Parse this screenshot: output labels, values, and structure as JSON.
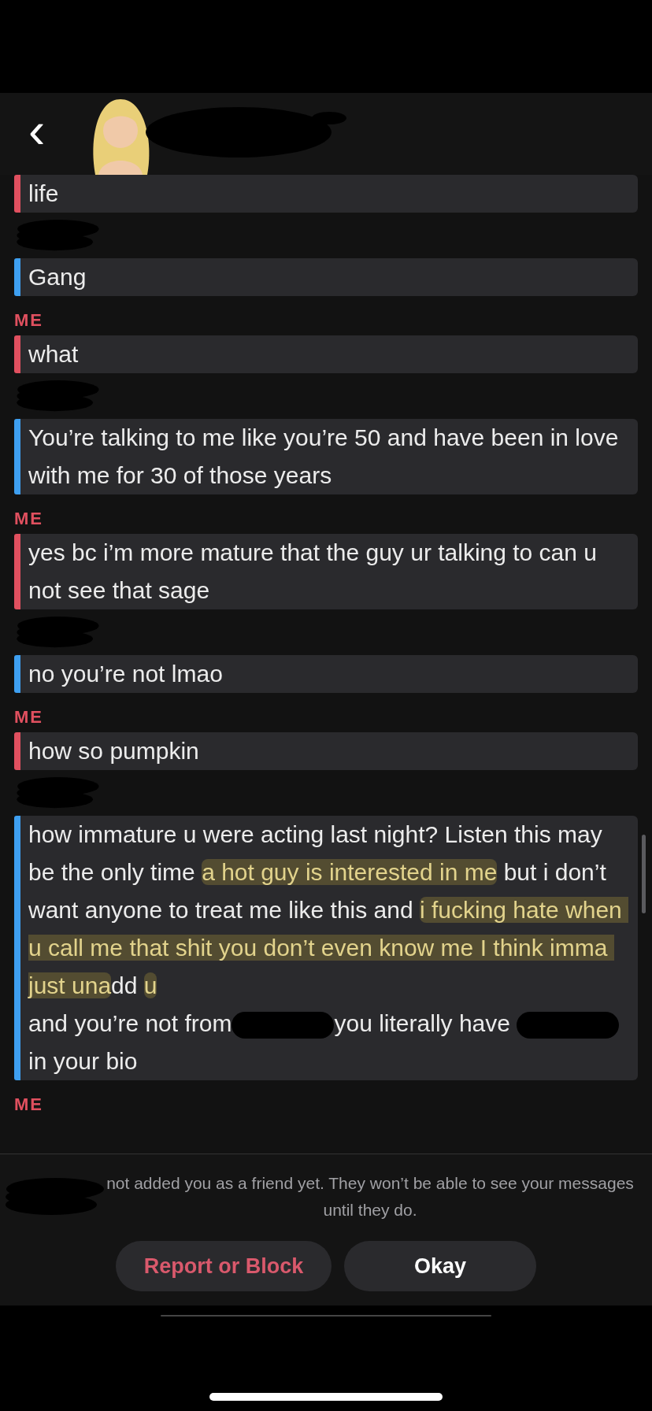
{
  "header": {
    "back": "‹",
    "name_redacted": true
  },
  "chat": [
    {
      "kind": "message",
      "color": "#e0505f",
      "segments": [
        {
          "text": "life"
        }
      ]
    },
    {
      "kind": "sender-hidden"
    },
    {
      "kind": "message",
      "color": "#3e9ff0",
      "segments": [
        {
          "text": "Gang"
        }
      ]
    },
    {
      "kind": "sender",
      "text": "ME"
    },
    {
      "kind": "message",
      "color": "#e0505f",
      "segments": [
        {
          "text": "what"
        }
      ]
    },
    {
      "kind": "sender-hidden"
    },
    {
      "kind": "message",
      "color": "#3e9ff0",
      "segments": [
        {
          "text": "You’re talking to me like you’re 50 and have been in love with me for 30 of those years"
        }
      ]
    },
    {
      "kind": "sender",
      "text": "ME"
    },
    {
      "kind": "message",
      "color": "#e0505f",
      "segments": [
        {
          "text": "yes bc i’m more mature that the guy ur talking to can u not see that sage"
        }
      ]
    },
    {
      "kind": "sender-hidden"
    },
    {
      "kind": "message",
      "color": "#3e9ff0",
      "segments": [
        {
          "text": "no you’re not lmao"
        }
      ]
    },
    {
      "kind": "sender",
      "text": "ME"
    },
    {
      "kind": "message",
      "color": "#e0505f",
      "segments": [
        {
          "text": "how so pumpkin"
        }
      ]
    },
    {
      "kind": "sender-hidden"
    },
    {
      "kind": "message",
      "color": "#3e9ff0",
      "segments": [
        {
          "text": "how immature u were acting last night? Listen this may be the only time "
        },
        {
          "text": "a hot guy is interested in me",
          "highlighted": true
        },
        {
          "text": " but i don’t want anyone to treat me like this and "
        },
        {
          "text": "i fucking hate when u call me that shit you don’t even know me I think imma just una",
          "highlighted": true
        },
        {
          "text": "dd "
        },
        {
          "text": "u",
          "highlighted": true
        },
        {
          "text": "\nand you’re not from"
        },
        {
          "kind": "redacted"
        },
        {
          "text": "you literally have "
        },
        {
          "kind": "redacted"
        },
        {
          "text": "in your bio"
        }
      ]
    },
    {
      "kind": "sender",
      "text": "ME"
    }
  ],
  "notice": {
    "redacted_prefix": true,
    "text": "not added you as a friend yet. They won’t be able to see your messages until they do."
  },
  "buttons": [
    {
      "label": "Report or Block",
      "kind": "danger"
    },
    {
      "label": "Okay",
      "kind": "normal"
    }
  ]
}
